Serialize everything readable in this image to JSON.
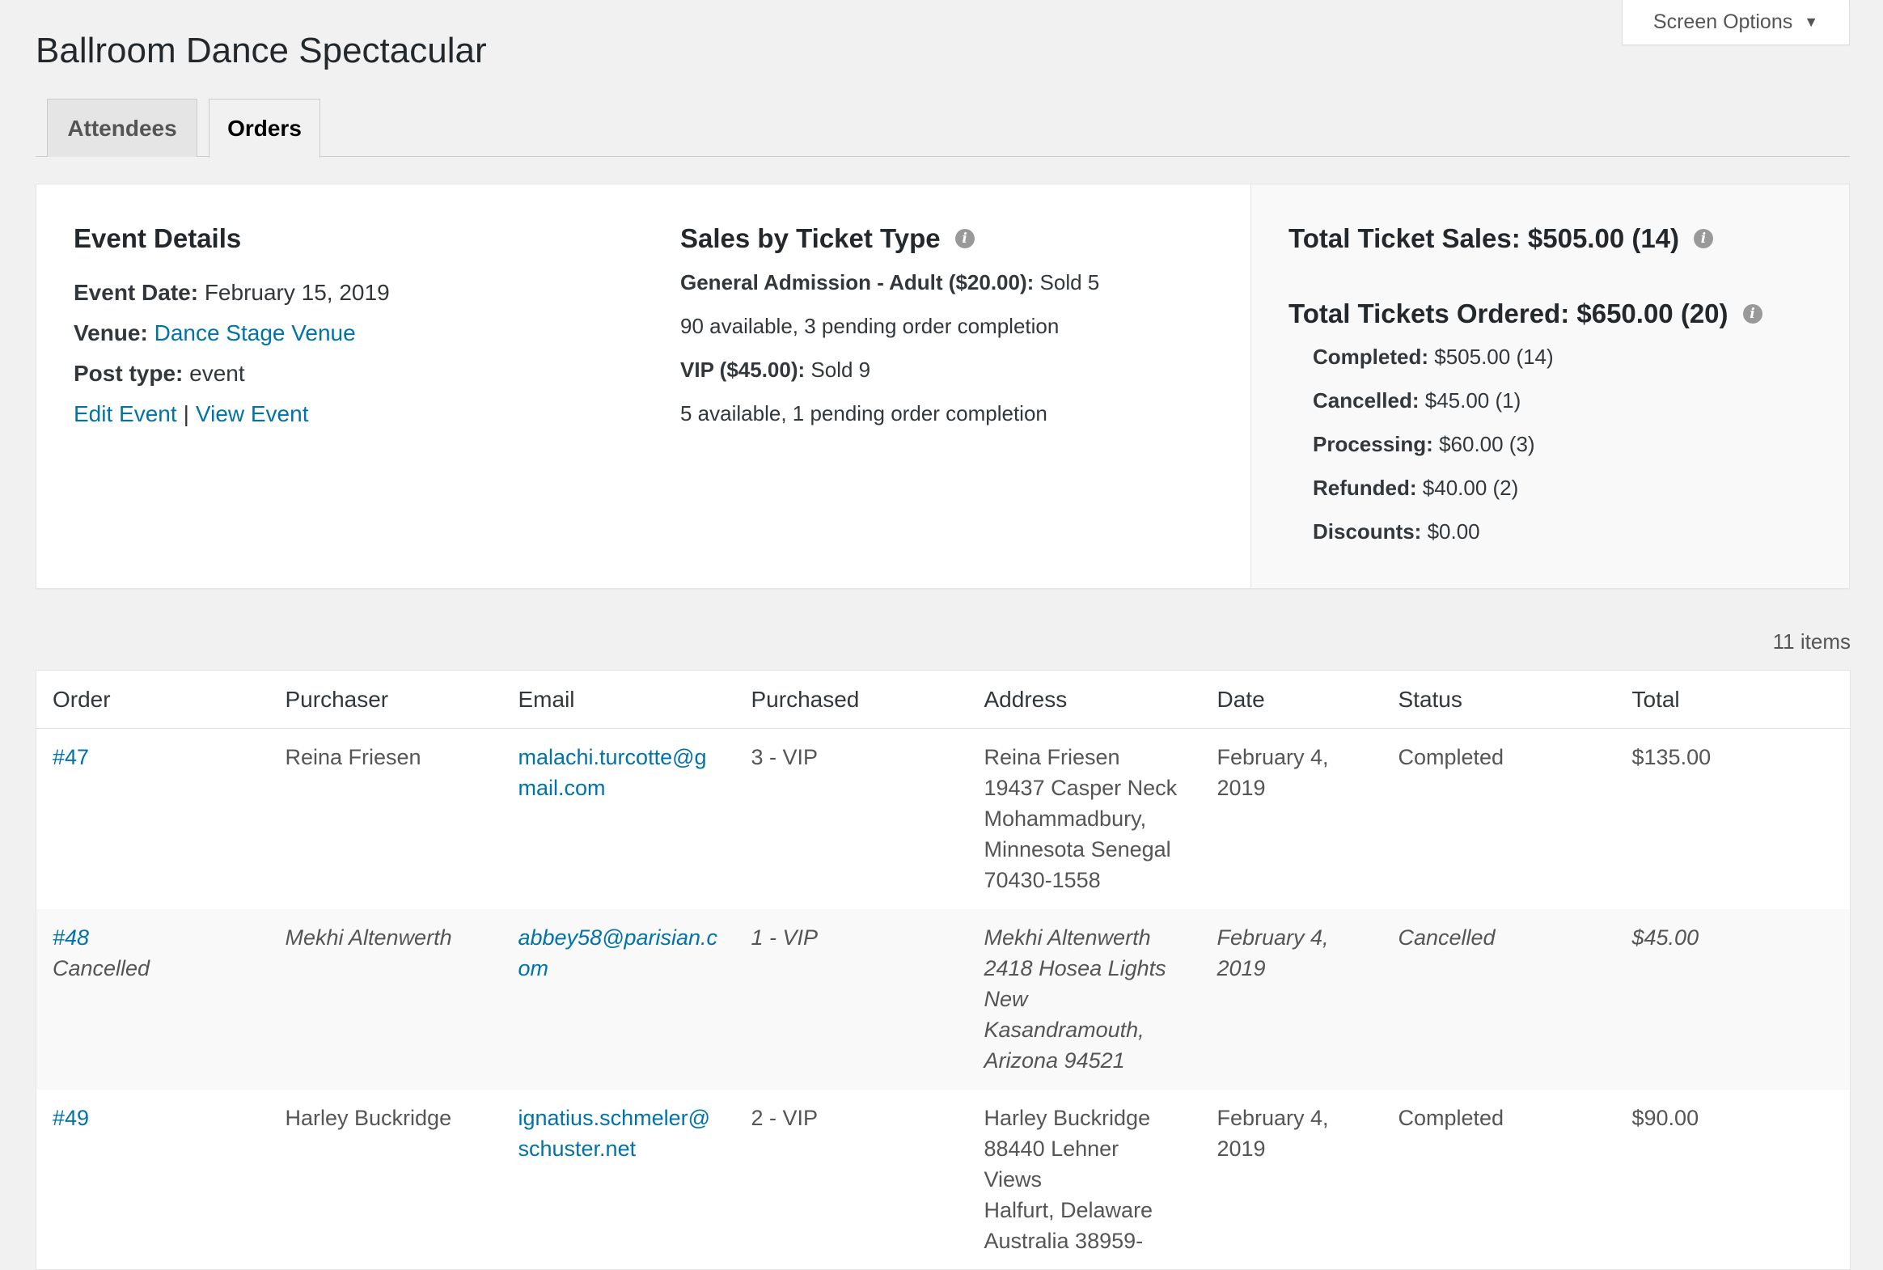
{
  "screen_options": {
    "label": "Screen Options",
    "caret": "▼"
  },
  "page_title": "Ballroom Dance Spectacular",
  "tabs": [
    {
      "label": "Attendees",
      "active": false
    },
    {
      "label": "Orders",
      "active": true
    }
  ],
  "event_details": {
    "heading": "Event Details",
    "event_date_label": "Event Date:",
    "event_date": "February 15, 2019",
    "venue_label": "Venue:",
    "venue": "Dance Stage Venue",
    "post_type_label": "Post type:",
    "post_type": "event",
    "edit_link": "Edit Event",
    "separator": "|",
    "view_link": "View Event"
  },
  "sales_by_type": {
    "heading": "Sales by Ticket Type",
    "tickets": [
      {
        "name": "General Admission - Adult ($20.00):",
        "sold": "Sold 5",
        "availability": "90 available, 3 pending order completion"
      },
      {
        "name": "VIP ($45.00):",
        "sold": "Sold 9",
        "availability": "5 available, 1 pending order completion"
      }
    ]
  },
  "totals": {
    "total_sales": "Total Ticket Sales: $505.00 (14)",
    "total_ordered": "Total Tickets Ordered: $650.00 (20)",
    "breakdown": [
      {
        "label": "Completed:",
        "value": "$505.00 (14)"
      },
      {
        "label": "Cancelled:",
        "value": "$45.00 (1)"
      },
      {
        "label": "Processing:",
        "value": "$60.00 (3)"
      },
      {
        "label": "Refunded:",
        "value": "$40.00 (2)"
      },
      {
        "label": "Discounts:",
        "value": "$0.00"
      }
    ]
  },
  "items_count": "11 items",
  "table": {
    "columns": [
      "Order",
      "Purchaser",
      "Email",
      "Purchased",
      "Address",
      "Date",
      "Status",
      "Total"
    ],
    "rows": [
      {
        "order": "#47",
        "order_note": "",
        "purchaser": "Reina Friesen",
        "email": "malachi.turcotte@gmail.com",
        "purchased": "3 - VIP",
        "address": [
          "Reina Friesen",
          "19437 Casper Neck",
          "Mohammadbury,",
          "Minnesota Senegal",
          "70430-1558"
        ],
        "date": "February 4, 2019",
        "status": "Completed",
        "total": "$135.00"
      },
      {
        "order": "#48",
        "order_note": "Cancelled",
        "purchaser": "Mekhi Altenwerth",
        "email": "abbey58@parisian.com",
        "purchased": "1 - VIP",
        "address": [
          "Mekhi Altenwerth",
          "2418 Hosea Lights",
          "New",
          "Kasandramouth,",
          "Arizona 94521"
        ],
        "date": "February 4, 2019",
        "status": "Cancelled",
        "total": "$45.00"
      },
      {
        "order": "#49",
        "order_note": "",
        "purchaser": "Harley Buckridge",
        "email": "ignatius.schmeler@schuster.net",
        "purchased": "2 - VIP",
        "address": [
          "Harley Buckridge",
          "88440 Lehner",
          "Views",
          "Halfurt, Delaware",
          "Australia 38959-"
        ],
        "date": "February 4, 2019",
        "status": "Completed",
        "total": "$90.00"
      }
    ]
  }
}
